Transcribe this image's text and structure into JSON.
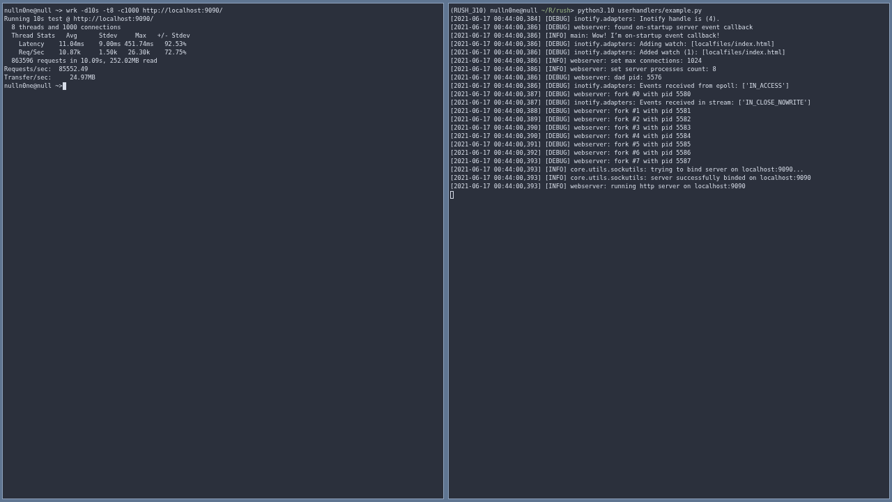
{
  "panes": [
    {
      "focused": true,
      "lines": [
        {
          "kind": "text",
          "text": "nulln0ne@null ~> wrk -d10s -t8 -c1000 http://localhost:9090/"
        },
        {
          "kind": "text",
          "text": "Running 10s test @ http://localhost:9090/"
        },
        {
          "kind": "text",
          "text": "  8 threads and 1000 connections"
        },
        {
          "kind": "text",
          "text": "  Thread Stats   Avg      Stdev     Max   +/- Stdev"
        },
        {
          "kind": "text",
          "text": "    Latency    11.04ms    9.00ms 451.74ms   92.53%"
        },
        {
          "kind": "text",
          "text": "    Req/Sec    10.87k     1.50k   26.30k    72.75%"
        },
        {
          "kind": "text",
          "text": "  863596 requests in 10.09s, 252.02MB read"
        },
        {
          "kind": "text",
          "text": "Requests/sec:  85552.49"
        },
        {
          "kind": "text",
          "text": "Transfer/sec:     24.97MB"
        }
      ],
      "input": "nulln0ne@null ~>"
    },
    {
      "focused": false,
      "lines": [
        {
          "kind": "prompt",
          "before": "(RUSH_310) nulln0ne@null ",
          "path": "~/R/rush",
          "after": "> python3.10 userhandlers/example.py"
        },
        {
          "kind": "text",
          "text": "[2021-06-17 00:44:00,384] [DEBUG] inotify.adapters: Inotify handle is (4)."
        },
        {
          "kind": "text",
          "text": "[2021-06-17 00:44:00,386] [DEBUG] webserver: found on-startup server event callback"
        },
        {
          "kind": "text",
          "text": "[2021-06-17 00:44:00,386] [INFO] main: Wow! I’m on-startup event callback!"
        },
        {
          "kind": "text",
          "text": "[2021-06-17 00:44:00,386] [DEBUG] inotify.adapters: Adding watch: [localfiles/index.html]"
        },
        {
          "kind": "text",
          "text": "[2021-06-17 00:44:00,386] [DEBUG] inotify.adapters: Added watch (1): [localfiles/index.html]"
        },
        {
          "kind": "text",
          "text": "[2021-06-17 00:44:00,386] [INFO] webserver: set max connections: 1024"
        },
        {
          "kind": "text",
          "text": "[2021-06-17 00:44:00,386] [INFO] webserver: set server processes count: 8"
        },
        {
          "kind": "text",
          "text": "[2021-06-17 00:44:00,386] [DEBUG] webserver: dad pid: 5576"
        },
        {
          "kind": "text",
          "text": "[2021-06-17 00:44:00,386] [DEBUG] inotify.adapters: Events received from epoll: ['IN_ACCESS']"
        },
        {
          "kind": "text",
          "text": "[2021-06-17 00:44:00,387] [DEBUG] webserver: fork #0 with pid 5580"
        },
        {
          "kind": "text",
          "text": "[2021-06-17 00:44:00,387] [DEBUG] inotify.adapters: Events received in stream: ['IN_CLOSE_NOWRITE']"
        },
        {
          "kind": "text",
          "text": "[2021-06-17 00:44:00,388] [DEBUG] webserver: fork #1 with pid 5581"
        },
        {
          "kind": "text",
          "text": "[2021-06-17 00:44:00,389] [DEBUG] webserver: fork #2 with pid 5582"
        },
        {
          "kind": "text",
          "text": "[2021-06-17 00:44:00,390] [DEBUG] webserver: fork #3 with pid 5583"
        },
        {
          "kind": "text",
          "text": "[2021-06-17 00:44:00,390] [DEBUG] webserver: fork #4 with pid 5584"
        },
        {
          "kind": "text",
          "text": "[2021-06-17 00:44:00,391] [DEBUG] webserver: fork #5 with pid 5585"
        },
        {
          "kind": "text",
          "text": "[2021-06-17 00:44:00,392] [DEBUG] webserver: fork #6 with pid 5586"
        },
        {
          "kind": "text",
          "text": "[2021-06-17 00:44:00,393] [DEBUG] webserver: fork #7 with pid 5587"
        },
        {
          "kind": "text",
          "text": "[2021-06-17 00:44:00,393] [INFO] core.utils.sockutils: trying to bind server on localhost:9090..."
        },
        {
          "kind": "text",
          "text": "[2021-06-17 00:44:00,393] [INFO] core.utils.sockutils: server successfully binded on localhost:9090"
        },
        {
          "kind": "text",
          "text": "[2021-06-17 00:44:00,393] [INFO] webserver: running http server on localhost:9090"
        }
      ]
    }
  ]
}
